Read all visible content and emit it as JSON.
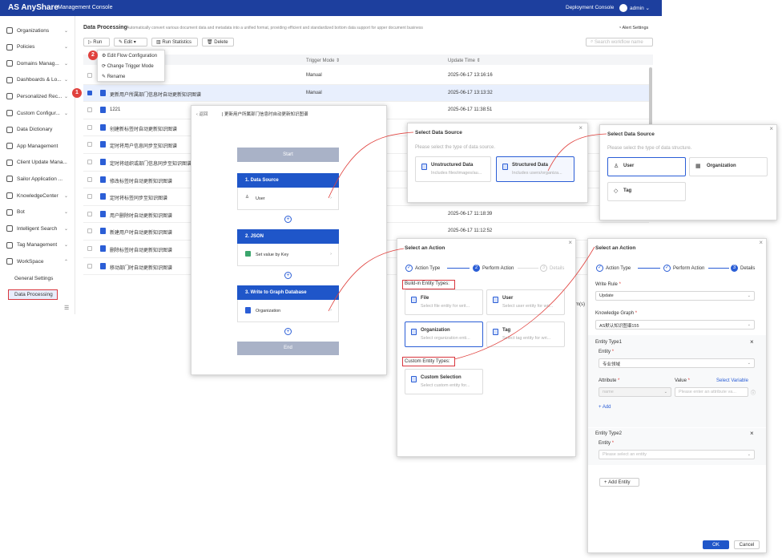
{
  "app": {
    "logo": "AnyShare",
    "console": "Management Console",
    "deployment": "Deployment Console",
    "user": "admin"
  },
  "sidebar": {
    "items": [
      {
        "label": "Organizations",
        "chev": "⌄"
      },
      {
        "label": "Policies",
        "chev": "⌄"
      },
      {
        "label": "Domains Manag...",
        "chev": "⌄"
      },
      {
        "label": "Dashboards & Lo...",
        "chev": "⌄"
      },
      {
        "label": "Personalized Rec...",
        "chev": "⌄"
      },
      {
        "label": "Custom Configur...",
        "chev": "⌄"
      },
      {
        "label": "Data Dictionary",
        "chev": ""
      },
      {
        "label": "App Management",
        "chev": ""
      },
      {
        "label": "Client Update Mana...",
        "chev": ""
      },
      {
        "label": "Sailor Application ...",
        "chev": ""
      },
      {
        "label": "KnowledgeCenter",
        "chev": "⌄"
      },
      {
        "label": "Bot",
        "chev": "⌄"
      },
      {
        "label": "Intelligent Search",
        "chev": "⌄"
      },
      {
        "label": "Tag Management",
        "chev": "⌄"
      },
      {
        "label": "WorkSpace",
        "chev": "⌃"
      }
    ],
    "sub1": "General Settings",
    "sub2": "Data Processing"
  },
  "main": {
    "title": "Data Processing",
    "desc": "Automatically convert various document data and metadata into a unified format, providing efficient and standardized bottom data support for upper document business",
    "alert": "Alert Settings",
    "run": "Run",
    "edit": "Edit",
    "stats": "Run Statistics",
    "delete": "Delete",
    "search": "Search workflow name",
    "col_trigger": "Trigger Mode",
    "col_update": "Update Time",
    "menu": [
      "Edit Flow Configuration",
      "Change Trigger Mode",
      "Rename"
    ],
    "rows": [
      {
        "name": "",
        "trigger": "Manual",
        "time": "2025-06-17 13:16:16"
      },
      {
        "name": "更新用户所属部门信息时自动更新知识图谱",
        "trigger": "Manual",
        "time": "2025-06-17 13:13:32"
      },
      {
        "name": "1221",
        "trigger": "",
        "time": "2025-06-17 11:38:51"
      },
      {
        "name": "创建新标签时自动更新知识图谱",
        "trigger": "",
        "time": ""
      },
      {
        "name": "定时将用户信息同步至知识图谱",
        "trigger": "",
        "time": ""
      },
      {
        "name": "定时将组织或部门信息同步至知识图谱",
        "trigger": "",
        "time": ""
      },
      {
        "name": "修改标签时自动更新知识图谱",
        "trigger": "",
        "time": ""
      },
      {
        "name": "定时将标签同步至知识图谱",
        "trigger": "",
        "time": ""
      },
      {
        "name": "用户删除时自动更新知识图谱",
        "trigger": "",
        "time": "2025-06-17 11:18:39"
      },
      {
        "name": "新建用户时自动更新知识图谱",
        "trigger": "",
        "time": "2025-06-17 11:12:52"
      },
      {
        "name": "删除标签时自动更新知识图谱",
        "trigger": "",
        "time": ""
      },
      {
        "name": "移动部门时自动更新知识图谱",
        "trigger": "",
        "time": ""
      }
    ],
    "tail": "m(s)"
  },
  "flow": {
    "back": "返回",
    "crumb": "更新用户所属部门信息时自动更新知识图谱",
    "start": "Start",
    "s1": "1. Data Source",
    "s1v": "User",
    "s2": "2. JSON",
    "s2v": "Set value by Key",
    "s3": "3. Write to Graph Database",
    "s3v": "Organization",
    "end": "End"
  },
  "ds1": {
    "title": "Select Data Source",
    "sub": "Please select the type of data source.",
    "c1": "Unstructured Data",
    "c1d": "Includes files/images/au...",
    "c2": "Structured Data",
    "c2d": "Includes users/organiza..."
  },
  "ds2": {
    "title": "Select Data Source",
    "sub": "Please select the type of data structure.",
    "c1": "User",
    "c2": "Organization",
    "c3": "Tag"
  },
  "act1": {
    "title": "Select an Action",
    "steps": [
      "Action Type",
      "Perform Action",
      "Details"
    ],
    "builtin": "Build-in Entity Types:",
    "custom": "Custom Entity Types:",
    "cards": [
      {
        "t": "File",
        "d": "Select file entity for writ..."
      },
      {
        "t": "User",
        "d": "Select user entity for wri..."
      },
      {
        "t": "Organization",
        "d": "Select organization enti..."
      },
      {
        "t": "Tag",
        "d": "Select tag entity for wri..."
      }
    ],
    "cs": "Custom Selection",
    "csd": "Select custom entity for..."
  },
  "act2": {
    "title": "Select an Action",
    "steps": [
      "Action Type",
      "Perform Action",
      "Details"
    ],
    "step3": "3",
    "write_rule": "Write Rule",
    "write_val": "Update",
    "kg": "Knowledge Graph",
    "kg_val": "AS默认知识图谱155",
    "et1": "Entity Type1",
    "entity": "Entity",
    "e1val": "专业领域",
    "attr": "Attribute",
    "value": "Value",
    "selvar": "Select Variable",
    "attr_ph": "name",
    "val_ph": "Please enter an attribute va...",
    "add": "Add",
    "et2": "Entity Type2",
    "e2ph": "Please select an entity",
    "addentity": "Add Entity",
    "ok": "OK",
    "cancel": "Cancel"
  },
  "badges": [
    "1",
    "2"
  ]
}
